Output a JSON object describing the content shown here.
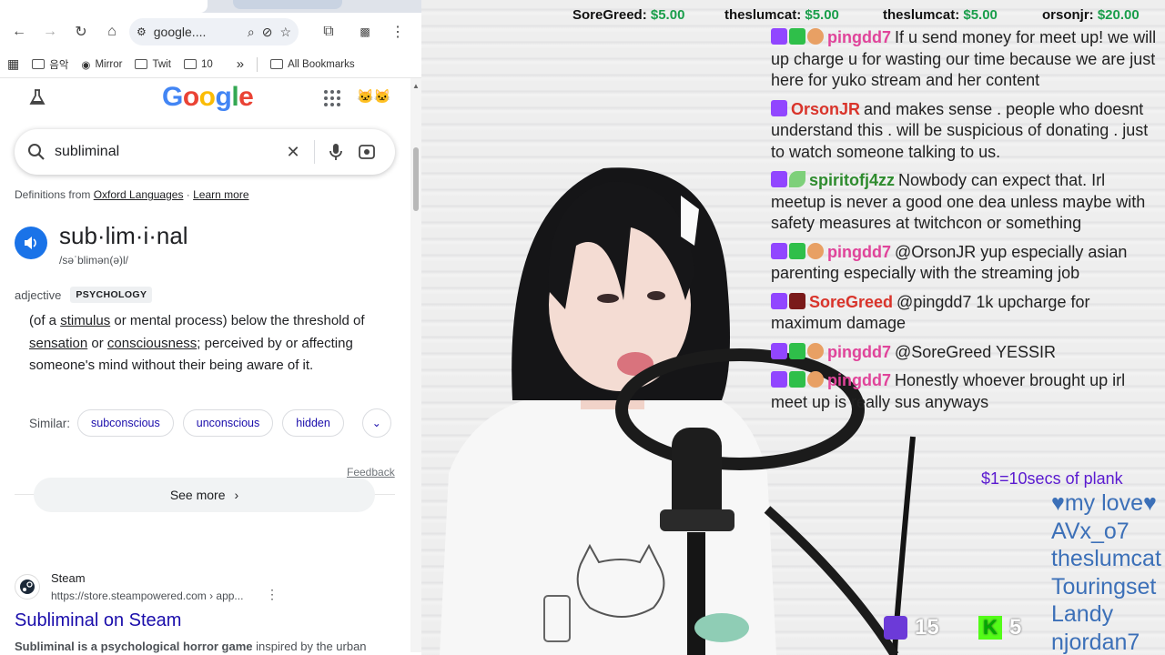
{
  "browser": {
    "address": "google....",
    "bookmarks": [
      "음악",
      "Mirror",
      "Twit",
      "10"
    ],
    "all_bookmarks": "All Bookmarks",
    "overflow": "»"
  },
  "google": {
    "logo": "Google",
    "query": "subliminal",
    "definitions_from_prefix": "Definitions from ",
    "definitions_source": "Oxford Languages",
    "learn_more": "Learn more",
    "word": "sub·lim·i·nal",
    "phonetic": "/səˈblimən(ə)l/",
    "part_of_speech": "adjective",
    "field_tag": "PSYCHOLOGY",
    "def_parts": [
      "(of a ",
      "stimulus",
      " or mental process) below the threshold of ",
      "sensation",
      " or ",
      "consciousness",
      "; perceived by or affecting someone's mind without their being aware of it."
    ],
    "similar_label": "Similar:",
    "similar": [
      "subconscious",
      "unconscious",
      "hidden"
    ],
    "feedback": "Feedback",
    "see_more": "See more",
    "result": {
      "site": "Steam",
      "url": "https://store.steampowered.com › app...",
      "title": "Subliminal on Steam",
      "snippet_bold": "Subliminal is a psychological horror game",
      "snippet_rest": " inspired by the urban"
    }
  },
  "stream": {
    "donations": [
      {
        "name": "SoreGreed:",
        "amount": "$5.00"
      },
      {
        "name": "theslumcat:",
        "amount": "$5.00"
      },
      {
        "name": "theslumcat:",
        "amount": "$5.00"
      },
      {
        "name": "orsonjr:",
        "amount": "$20.00"
      }
    ],
    "chat": [
      {
        "user": "pingdd7",
        "color": "#e0449a",
        "text": "If u send money for meet up! we will up charge u for wasting our time because we are just here for yuko stream and her content"
      },
      {
        "user": "OrsonJR",
        "color": "#d9342b",
        "text": "and makes sense . people who doesnt understand this . will be suspicious of donating . just to watch someone talking to us."
      },
      {
        "user": "spiritofj4zz",
        "color": "#2e8b2e",
        "text": "Nowbody can expect that. Irl meetup is never a good one dea unless maybe with safety measures at twitchcon or something"
      },
      {
        "user": "pingdd7",
        "color": "#e0449a",
        "text": "@OrsonJR yup especially asian parenting especially with the streaming job"
      },
      {
        "user": "SoreGreed",
        "color": "#d9342b",
        "text": "@pingdd7 1k upcharge for maximum damage"
      },
      {
        "user": "pingdd7",
        "color": "#e0449a",
        "text": "@SoreGreed YESSIR"
      },
      {
        "user": "pingdd7",
        "color": "#e0449a",
        "text": "Honestly whoever brought up irl meet up is really sus anyways"
      }
    ],
    "plank": "$1=10secs of plank",
    "credits": [
      "♥my love♥",
      "AVx_o7",
      "theslumcat",
      "Touringset",
      "Landy",
      "njordan7"
    ],
    "twitch_viewers": "15",
    "kick_viewers": "5"
  }
}
